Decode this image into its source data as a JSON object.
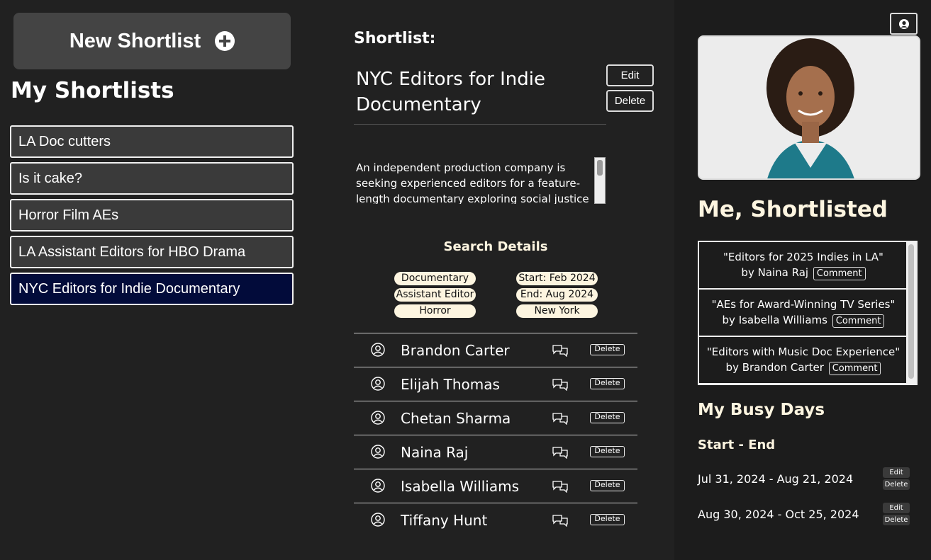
{
  "sidebar": {
    "new_button_label": "New Shortlist",
    "title": "My Shortlists",
    "items": [
      {
        "label": "LA Doc cutters"
      },
      {
        "label": "Is it cake?"
      },
      {
        "label": "Horror Film AEs"
      },
      {
        "label": "LA Assistant Editors for HBO Drama"
      },
      {
        "label": "NYC Editors for Indie Documentary"
      }
    ],
    "active_color": "#020b3a"
  },
  "shortlist": {
    "label": "Shortlist:",
    "name": "NYC Editors for Indie Documentary",
    "edit_label": "Edit",
    "delete_label": "Delete",
    "description": "An independent production company is seeking experienced editors for a feature-length documentary exploring social justice",
    "search_title": "Search Details",
    "tags_left": [
      "Documentary",
      "Assistant Editor",
      "Horror"
    ],
    "tags_right": [
      "Start: Feb 2024",
      "End: Aug 2024",
      "New York"
    ],
    "people": [
      {
        "name": "Brandon Carter",
        "delete": "Delete"
      },
      {
        "name": "Elijah Thomas",
        "delete": "Delete"
      },
      {
        "name": "Chetan Sharma",
        "delete": "Delete"
      },
      {
        "name": "Naina Raj",
        "delete": "Delete"
      },
      {
        "name": "Isabella Williams",
        "delete": "Delete"
      },
      {
        "name": "Tiffany Hunt",
        "delete": "Delete"
      }
    ]
  },
  "profile": {
    "account_icon": "user-circle-icon",
    "me_title": "Me, Shortlisted",
    "comments": [
      {
        "title": "\"Editors for 2025 Indies in LA\"",
        "by": "by Naina Raj",
        "button": "Comment"
      },
      {
        "title": "\"AEs for Award-Winning TV Series\"",
        "by": "by Isabella Williams",
        "button": "Comment"
      },
      {
        "title": "\"Editors with Music Doc Experience\"",
        "by": "by Brandon Carter",
        "button": "Comment"
      }
    ],
    "busy_title": "My Busy Days",
    "range_header": "Start - End",
    "busy_days": [
      {
        "range": "Jul 31, 2024 - Aug 21, 2024",
        "edit": "Edit",
        "delete": "Delete"
      },
      {
        "range": "Aug 30, 2024 - Oct 25, 2024",
        "edit": "Edit",
        "delete": "Delete"
      }
    ]
  }
}
